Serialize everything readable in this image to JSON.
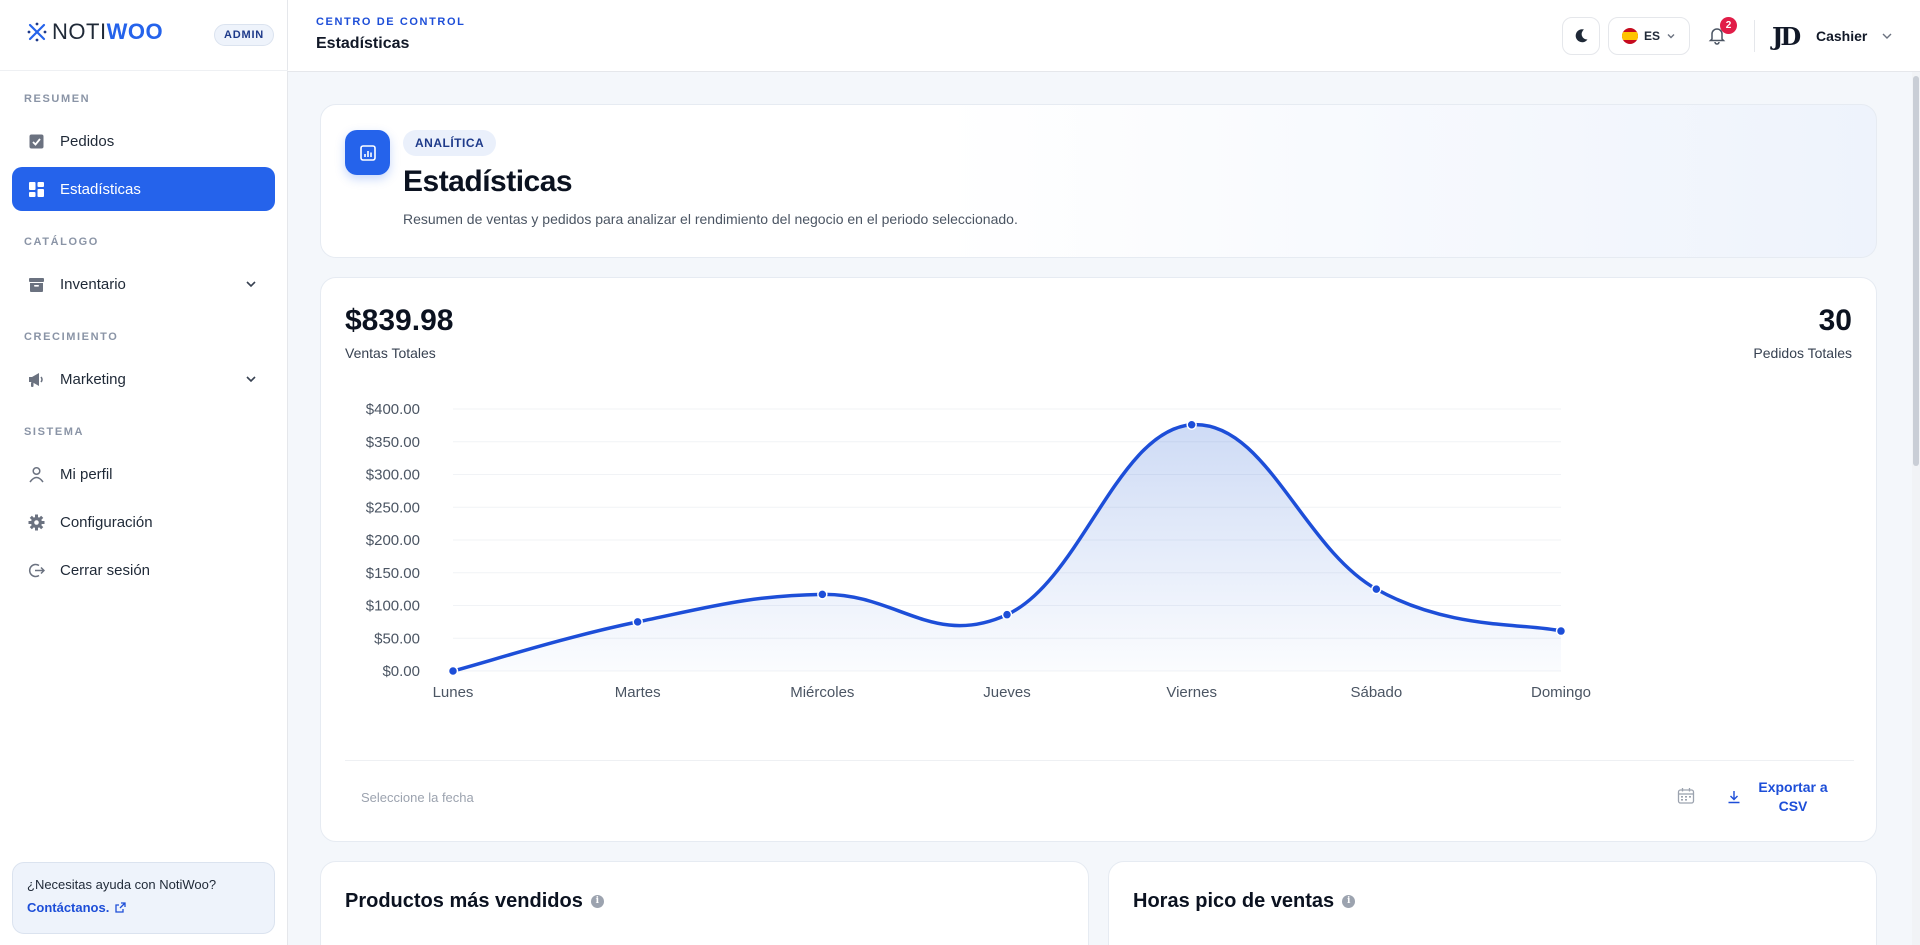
{
  "brand": {
    "prefix": "NOTI",
    "suffix": "WOO",
    "role_badge": "ADMIN"
  },
  "sidebar": {
    "sections": [
      {
        "label": "RESUMEN"
      },
      {
        "label": "CATÁLOGO"
      },
      {
        "label": "CRECIMIENTO"
      },
      {
        "label": "SISTEMA"
      }
    ],
    "items": [
      {
        "label": "Pedidos",
        "icon": "clipboard-icon"
      },
      {
        "label": "Estadísticas",
        "icon": "dashboard-icon",
        "active": true
      },
      {
        "label": "Inventario",
        "icon": "archive-icon",
        "expandable": true
      },
      {
        "label": "Marketing",
        "icon": "megaphone-icon",
        "expandable": true
      },
      {
        "label": "Mi perfil",
        "icon": "user-icon"
      },
      {
        "label": "Configuración",
        "icon": "gear-icon"
      },
      {
        "label": "Cerrar sesión",
        "icon": "logout-icon"
      }
    ],
    "help": {
      "question": "¿Necesitas ayuda con NotiWoo?",
      "link": "Contáctanos."
    }
  },
  "header": {
    "kicker": "CENTRO DE CONTROL",
    "title": "Estadísticas",
    "language": "ES",
    "notifications": "2",
    "user_initials": "JD",
    "user_name": "Cashier"
  },
  "hero": {
    "pill": "ANALÍTICA",
    "title": "Estadísticas",
    "subtitle": "Resumen de ventas y pedidos para analizar el rendimiento del negocio en el periodo seleccionado."
  },
  "stats": {
    "total_sales": "$839.98",
    "total_sales_label": "Ventas Totales",
    "total_orders": "30",
    "total_orders_label": "Pedidos Totales",
    "date_placeholder": "Seleccione la fecha",
    "export_label": "Exportar a CSV"
  },
  "chart_data": {
    "type": "area",
    "categories": [
      "Lunes",
      "Martes",
      "Miércoles",
      "Jueves",
      "Viernes",
      "Sábado",
      "Domingo"
    ],
    "values": [
      0,
      75,
      117,
      86,
      376,
      125,
      61
    ],
    "ylim": [
      0,
      400
    ],
    "yticks": [
      "$0.00",
      "$50.00",
      "$100.00",
      "$150.00",
      "$200.00",
      "$250.00",
      "$300.00",
      "$350.00",
      "$400.00"
    ],
    "ytick_values": [
      0,
      50,
      100,
      150,
      200,
      250,
      300,
      350,
      400
    ],
    "grid": true,
    "legend": "none",
    "line_color": "#1d4ed8"
  },
  "panels": {
    "left_title": "Productos más vendidos",
    "right_title": "Horas pico de ventas"
  },
  "colors": {
    "accent": "#2563eb",
    "badge": "#e11d48"
  }
}
